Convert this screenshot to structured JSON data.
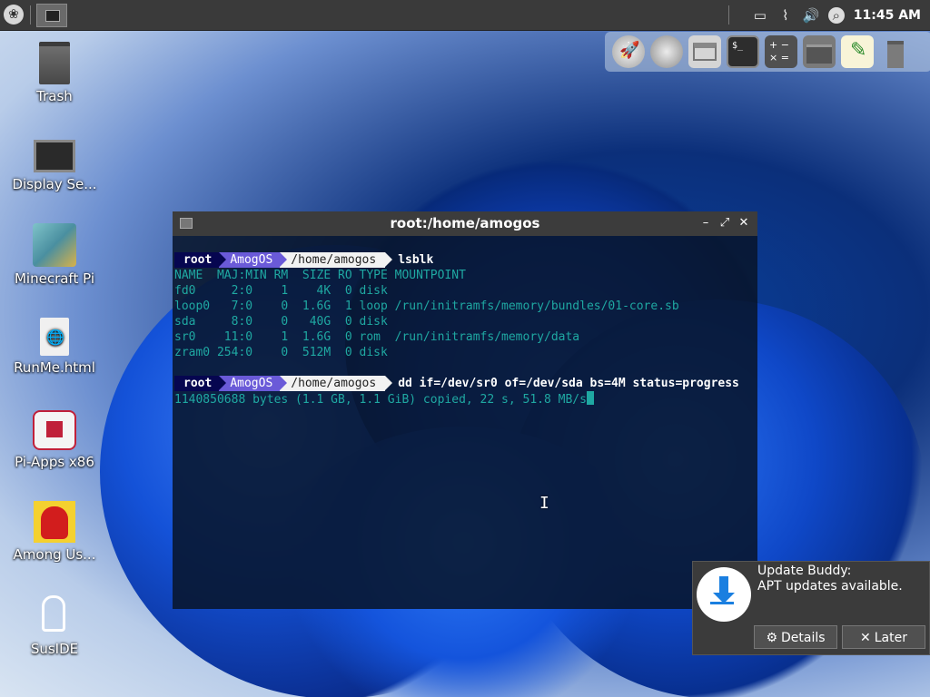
{
  "panel": {
    "clock": "11:45 AM",
    "menu_icon": "raspberry-menu-icon",
    "tray_icons": [
      "message-icon",
      "paperclip-icon",
      "volume-icon",
      "search-icon"
    ]
  },
  "dock": {
    "items": [
      "rocket-launcher-icon",
      "face-app-icon",
      "window-manager-icon",
      "terminal-icon",
      "calculator-icon",
      "file-manager-icon",
      "text-editor-icon",
      "trash-icon"
    ]
  },
  "desktop": {
    "icons": [
      {
        "label": "Trash"
      },
      {
        "label": "Display Se..."
      },
      {
        "label": "Minecraft Pi"
      },
      {
        "label": "RunMe.html"
      },
      {
        "label": "Pi-Apps x86"
      },
      {
        "label": "Among Us..."
      },
      {
        "label": "SusIDE"
      }
    ]
  },
  "terminal": {
    "title": "root:/home/amogos",
    "controls": {
      "minimize": "–",
      "maximize": "⤢",
      "close": "✕"
    },
    "prompt": {
      "user": "root",
      "host": "AmogOS",
      "path": "/home/amogos"
    },
    "cmd1": "lsblk",
    "lsblk_lines": [
      "NAME  MAJ:MIN RM  SIZE RO TYPE MOUNTPOINT",
      "fd0     2:0    1    4K  0 disk",
      "loop0   7:0    0  1.6G  1 loop /run/initramfs/memory/bundles/01-core.sb",
      "sda     8:0    0   40G  0 disk",
      "sr0    11:0    1  1.6G  0 rom  /run/initramfs/memory/data",
      "zram0 254:0    0  512M  0 disk"
    ],
    "cmd2": "dd if=/dev/sr0 of=/dev/sda bs=4M status=progress",
    "progress": "1140850688 bytes (1.1 GB, 1.1 GiB) copied, 22 s, 51.8 MB/s"
  },
  "notification": {
    "title": "Update Buddy:",
    "message": "APT updates available.",
    "details_label": "Details",
    "later_label": "Later"
  },
  "colors": {
    "prompt_user_bg": "#060650",
    "prompt_host_bg": "#6a5ad8",
    "prompt_path_bg": "#f2f2f2",
    "terminal_text": "#1fa8a2"
  }
}
